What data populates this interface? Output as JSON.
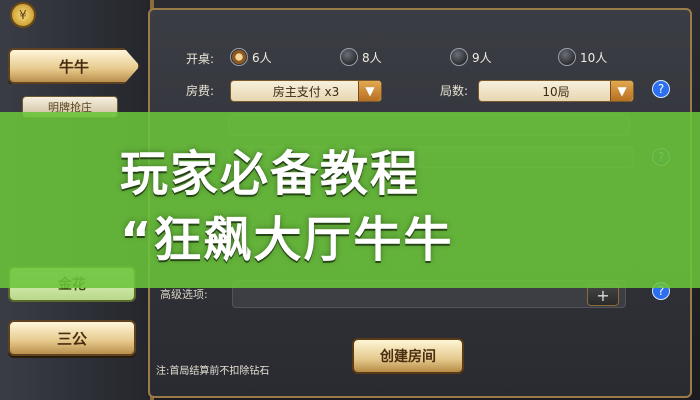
{
  "sidebar": {
    "niuniu_label": "牛牛",
    "mingpai_label": "明牌抢庄",
    "jinhua_label": "金花",
    "sangong_label": "三公"
  },
  "form": {
    "table_label": "开桌:",
    "options": [
      {
        "label": "6人",
        "selected": true
      },
      {
        "label": "8人",
        "selected": false
      },
      {
        "label": "9人",
        "selected": false
      },
      {
        "label": "10人",
        "selected": false
      }
    ],
    "fee_label": "房费:",
    "fee_value": "房主支付 x3",
    "rounds_label": "局数:",
    "rounds_value": "10局",
    "adv_label": "高级选项:",
    "note": "注:首局结算前不扣除钻石",
    "create_label": "创建房间",
    "help_glyph": "?"
  },
  "banner": {
    "line1": "玩家必备教程",
    "line2": "“狂飙大厅牛牛"
  },
  "colors": {
    "banner_green": "#6ac43a",
    "gold_border": "#9b7c46",
    "help_blue": "#2c6ef0"
  }
}
